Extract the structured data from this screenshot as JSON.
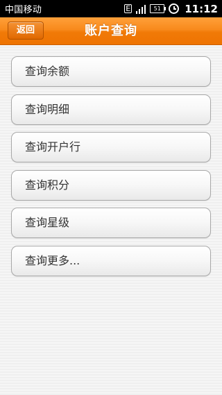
{
  "status_bar": {
    "carrier": "中国移动",
    "network": "E",
    "battery": "51",
    "time": "11:12"
  },
  "header": {
    "back_label": "返回",
    "title": "账户查询"
  },
  "menu": {
    "items": [
      {
        "label": "查询余额"
      },
      {
        "label": "查询明细"
      },
      {
        "label": "查询开户行"
      },
      {
        "label": "查询积分"
      },
      {
        "label": "查询星级"
      },
      {
        "label": "查询更多..."
      }
    ]
  },
  "colors": {
    "accent": "#f17a07",
    "status_bar": "#000000",
    "background": "#f0f0f0"
  }
}
